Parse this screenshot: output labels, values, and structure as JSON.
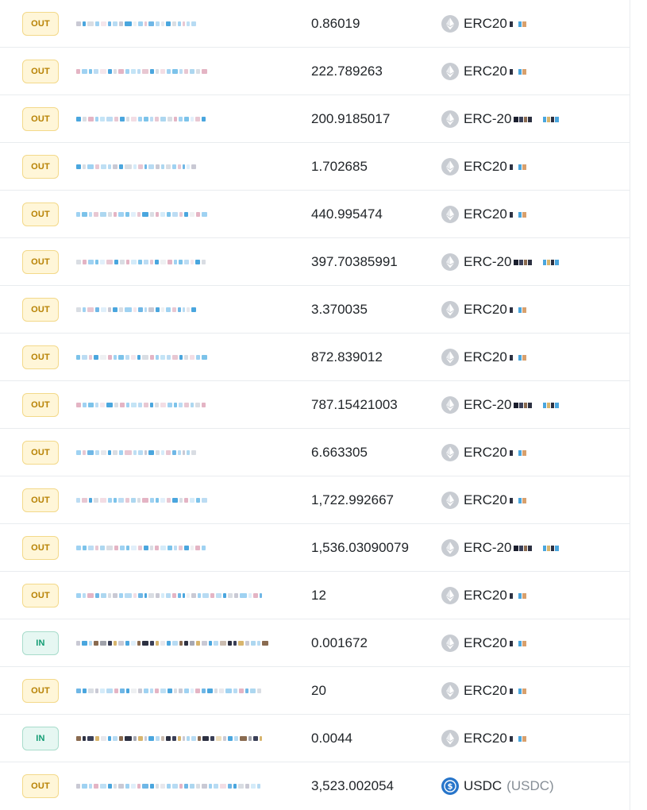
{
  "colors": {
    "out_bg": "#fff6d8",
    "out_text": "#b78103",
    "in_bg": "#e6f7f2",
    "in_text": "#129c73",
    "eth_icon": "#c8ccd2",
    "usdc_icon": "#2775ca"
  },
  "rows": [
    {
      "direction": "OUT",
      "amount": "0.86019",
      "token": "ERC20",
      "token_sub": "",
      "icon": "ethereum-icon"
    },
    {
      "direction": "OUT",
      "amount": "222.789263",
      "token": "ERC20",
      "token_sub": "",
      "icon": "ethereum-icon"
    },
    {
      "direction": "OUT",
      "amount": "200.9185017",
      "token": "ERC-20",
      "token_sub": "",
      "icon": "ethereum-icon"
    },
    {
      "direction": "OUT",
      "amount": "1.702685",
      "token": "ERC20",
      "token_sub": "",
      "icon": "ethereum-icon"
    },
    {
      "direction": "OUT",
      "amount": "440.995474",
      "token": "ERC20",
      "token_sub": "",
      "icon": "ethereum-icon"
    },
    {
      "direction": "OUT",
      "amount": "397.70385991",
      "token": "ERC-20",
      "token_sub": "",
      "icon": "ethereum-icon"
    },
    {
      "direction": "OUT",
      "amount": "3.370035",
      "token": "ERC20",
      "token_sub": "",
      "icon": "ethereum-icon"
    },
    {
      "direction": "OUT",
      "amount": "872.839012",
      "token": "ERC20",
      "token_sub": "",
      "icon": "ethereum-icon"
    },
    {
      "direction": "OUT",
      "amount": "787.15421003",
      "token": "ERC-20",
      "token_sub": "",
      "icon": "ethereum-icon"
    },
    {
      "direction": "OUT",
      "amount": "6.663305",
      "token": "ERC20",
      "token_sub": "",
      "icon": "ethereum-icon"
    },
    {
      "direction": "OUT",
      "amount": "1,722.992667",
      "token": "ERC20",
      "token_sub": "",
      "icon": "ethereum-icon"
    },
    {
      "direction": "OUT",
      "amount": "1,536.03090079",
      "token": "ERC-20",
      "token_sub": "",
      "icon": "ethereum-icon"
    },
    {
      "direction": "OUT",
      "amount": "12",
      "token": "ERC20",
      "token_sub": "",
      "icon": "ethereum-icon"
    },
    {
      "direction": "IN",
      "amount": "0.001672",
      "token": "ERC20",
      "token_sub": "",
      "icon": "ethereum-icon"
    },
    {
      "direction": "OUT",
      "amount": "20",
      "token": "ERC20",
      "token_sub": "",
      "icon": "ethereum-icon"
    },
    {
      "direction": "IN",
      "amount": "0.0044",
      "token": "ERC20",
      "token_sub": "",
      "icon": "ethereum-icon"
    },
    {
      "direction": "OUT",
      "amount": "3,523.002054",
      "token": "USDC",
      "token_sub": "(USDC)",
      "icon": "usdc-icon"
    }
  ]
}
